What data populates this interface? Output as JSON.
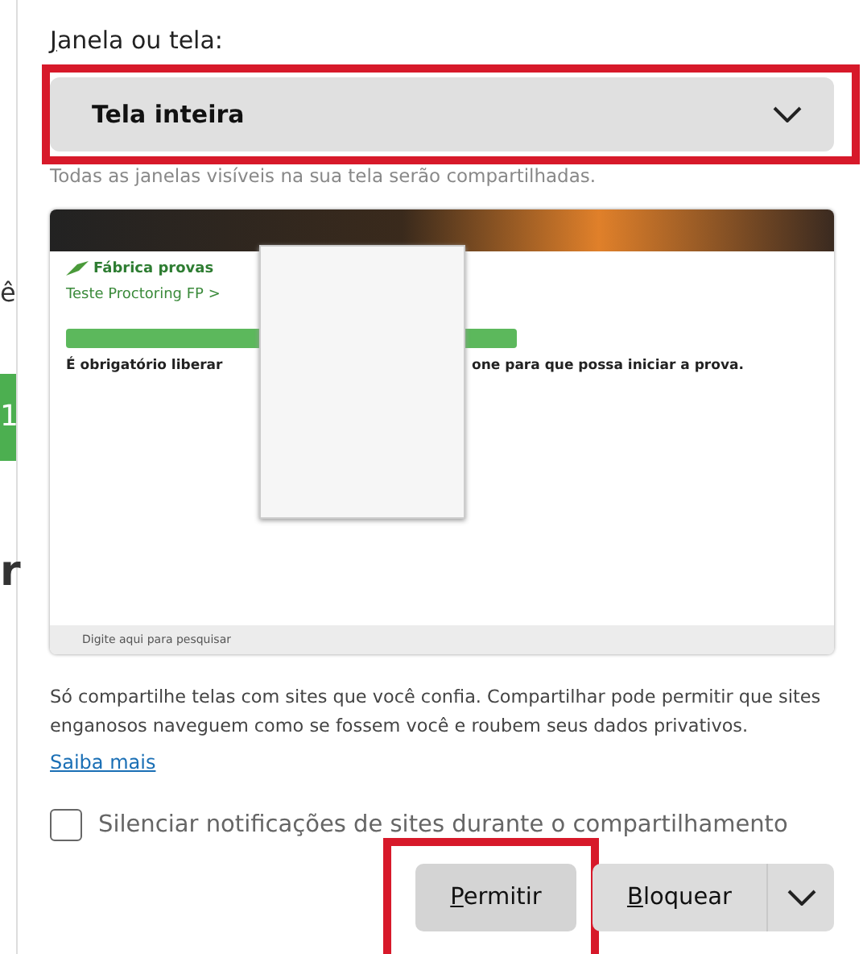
{
  "background_page": {
    "fragments": [
      "ê",
      "1",
      "r"
    ]
  },
  "source": {
    "label": "Janela ou tela:",
    "value": "Tela inteira",
    "highlighted": true,
    "note": "Todas as janelas visíveis na sua tela serão compartilhadas."
  },
  "preview": {
    "logo": "Fábrica provas",
    "breadcrumb": "Teste Proctoring FP >",
    "message_start": "É obrigatório liberar",
    "message_end": "one para que possa iniciar a prova.",
    "taskbar_search": "Digite aqui para pesquisar"
  },
  "warning": "Só compartilhe telas com sites que você confia. Compartilhar pode permitir que sites enganosos naveguem como se fossem você e roubem seus dados privativos.",
  "learn_more": "Saiba mais",
  "mute_option": {
    "label": "Silenciar notificações de sites durante o compartilhamento",
    "checked": false
  },
  "buttons": [
    {
      "kind": "allow",
      "label": "Permitir",
      "highlighted": true
    },
    {
      "kind": "block",
      "label": "Bloquear"
    }
  ]
}
